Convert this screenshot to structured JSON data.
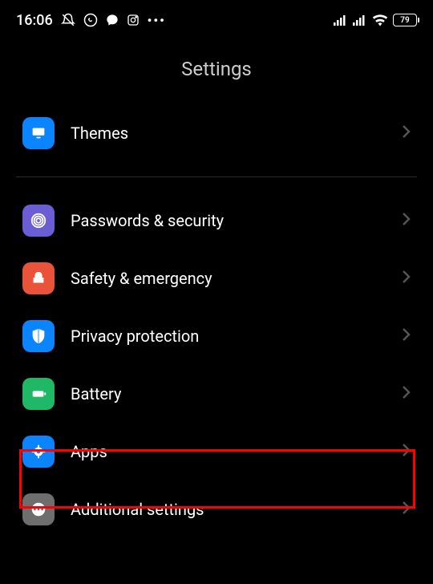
{
  "status": {
    "time": "16:06",
    "battery": "79"
  },
  "page": {
    "title": "Settings"
  },
  "items": [
    {
      "label": "Themes",
      "icon": "themes",
      "bg": "#0a84ff"
    },
    {
      "label": "Passwords & security",
      "icon": "fingerprint",
      "bg": "#6b5dd3"
    },
    {
      "label": "Safety & emergency",
      "icon": "emergency",
      "bg": "#e8533a"
    },
    {
      "label": "Privacy protection",
      "icon": "shield",
      "bg": "#0a84ff"
    },
    {
      "label": "Battery",
      "icon": "battery",
      "bg": "#1fb866"
    },
    {
      "label": "Apps",
      "icon": "apps",
      "bg": "#0a84ff"
    },
    {
      "label": "Additional settings",
      "icon": "more",
      "bg": "#6e6e6e"
    }
  ]
}
